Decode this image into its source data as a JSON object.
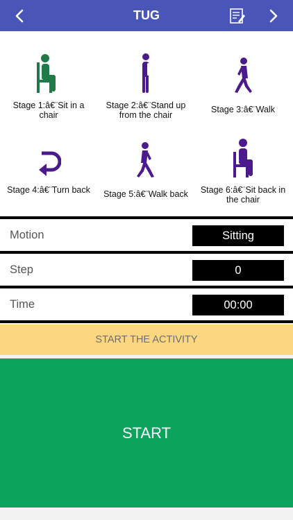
{
  "header": {
    "title": "TUG",
    "back_icon": "chevron-left-icon",
    "notes_icon": "notes-edit-icon",
    "forward_icon": "chevron-right-icon"
  },
  "colors": {
    "header_bg": "#4a55b8",
    "stage_green": "#1f7a48",
    "stage_purple": "#4b1a8c",
    "activity_bg": "#fdd77f",
    "start_bg": "#0ca35c"
  },
  "stages": [
    {
      "label": "Stage 1:â€¨Sit in a chair",
      "icon": "sitting-person-icon"
    },
    {
      "label": "Stage 2:â€¨Stand up from the chair",
      "icon": "standing-person-icon"
    },
    {
      "label": "Stage 3:â€¨Walk",
      "icon": "walking-person-icon"
    },
    {
      "label": "Stage 4:â€¨Turn back",
      "icon": "turn-back-arrow-icon"
    },
    {
      "label": "Stage 5:â€¨Walk back",
      "icon": "walking-person-icon"
    },
    {
      "label": "Stage 6:â€¨Sit back in the chair",
      "icon": "sitting-person-icon"
    }
  ],
  "metrics": {
    "motion": {
      "label": "Motion",
      "value": "Sitting"
    },
    "step": {
      "label": "Step",
      "value": "0"
    },
    "time": {
      "label": "Time",
      "value": "00:00"
    }
  },
  "activity_banner": "START THE ACTIVITY",
  "start_button": "START"
}
